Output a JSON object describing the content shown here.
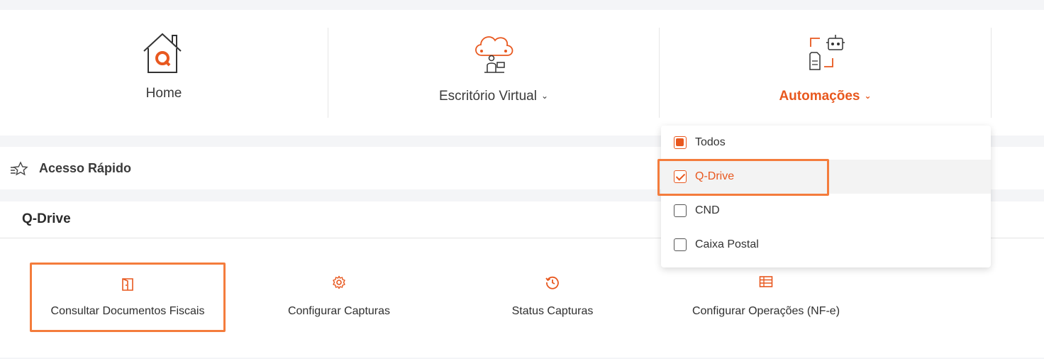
{
  "nav": {
    "home_label": "Home",
    "virtual_label": "Escritório Virtual",
    "automations_label": "Automações",
    "chevron": "⌄"
  },
  "quick_access": {
    "label": "Acesso Rápido",
    "icon": "star-list-icon"
  },
  "section": {
    "title": "Q-Drive",
    "tiles": [
      {
        "label": "Consultar Documentos Fiscais",
        "icon": "door-icon"
      },
      {
        "label": "Configurar Capturas",
        "icon": "gear-icon"
      },
      {
        "label": "Status Capturas",
        "icon": "history-icon"
      },
      {
        "label": "Configurar Operações (NF-e)",
        "icon": "table-icon"
      }
    ]
  },
  "dropdown": {
    "items": [
      {
        "label": "Todos",
        "state": "partial"
      },
      {
        "label": "Q-Drive",
        "state": "checked"
      },
      {
        "label": "CND",
        "state": "unchecked"
      },
      {
        "label": "Caixa Postal",
        "state": "unchecked"
      }
    ]
  },
  "colors": {
    "accent": "#e8581f",
    "highlight": "#f47c3c"
  }
}
